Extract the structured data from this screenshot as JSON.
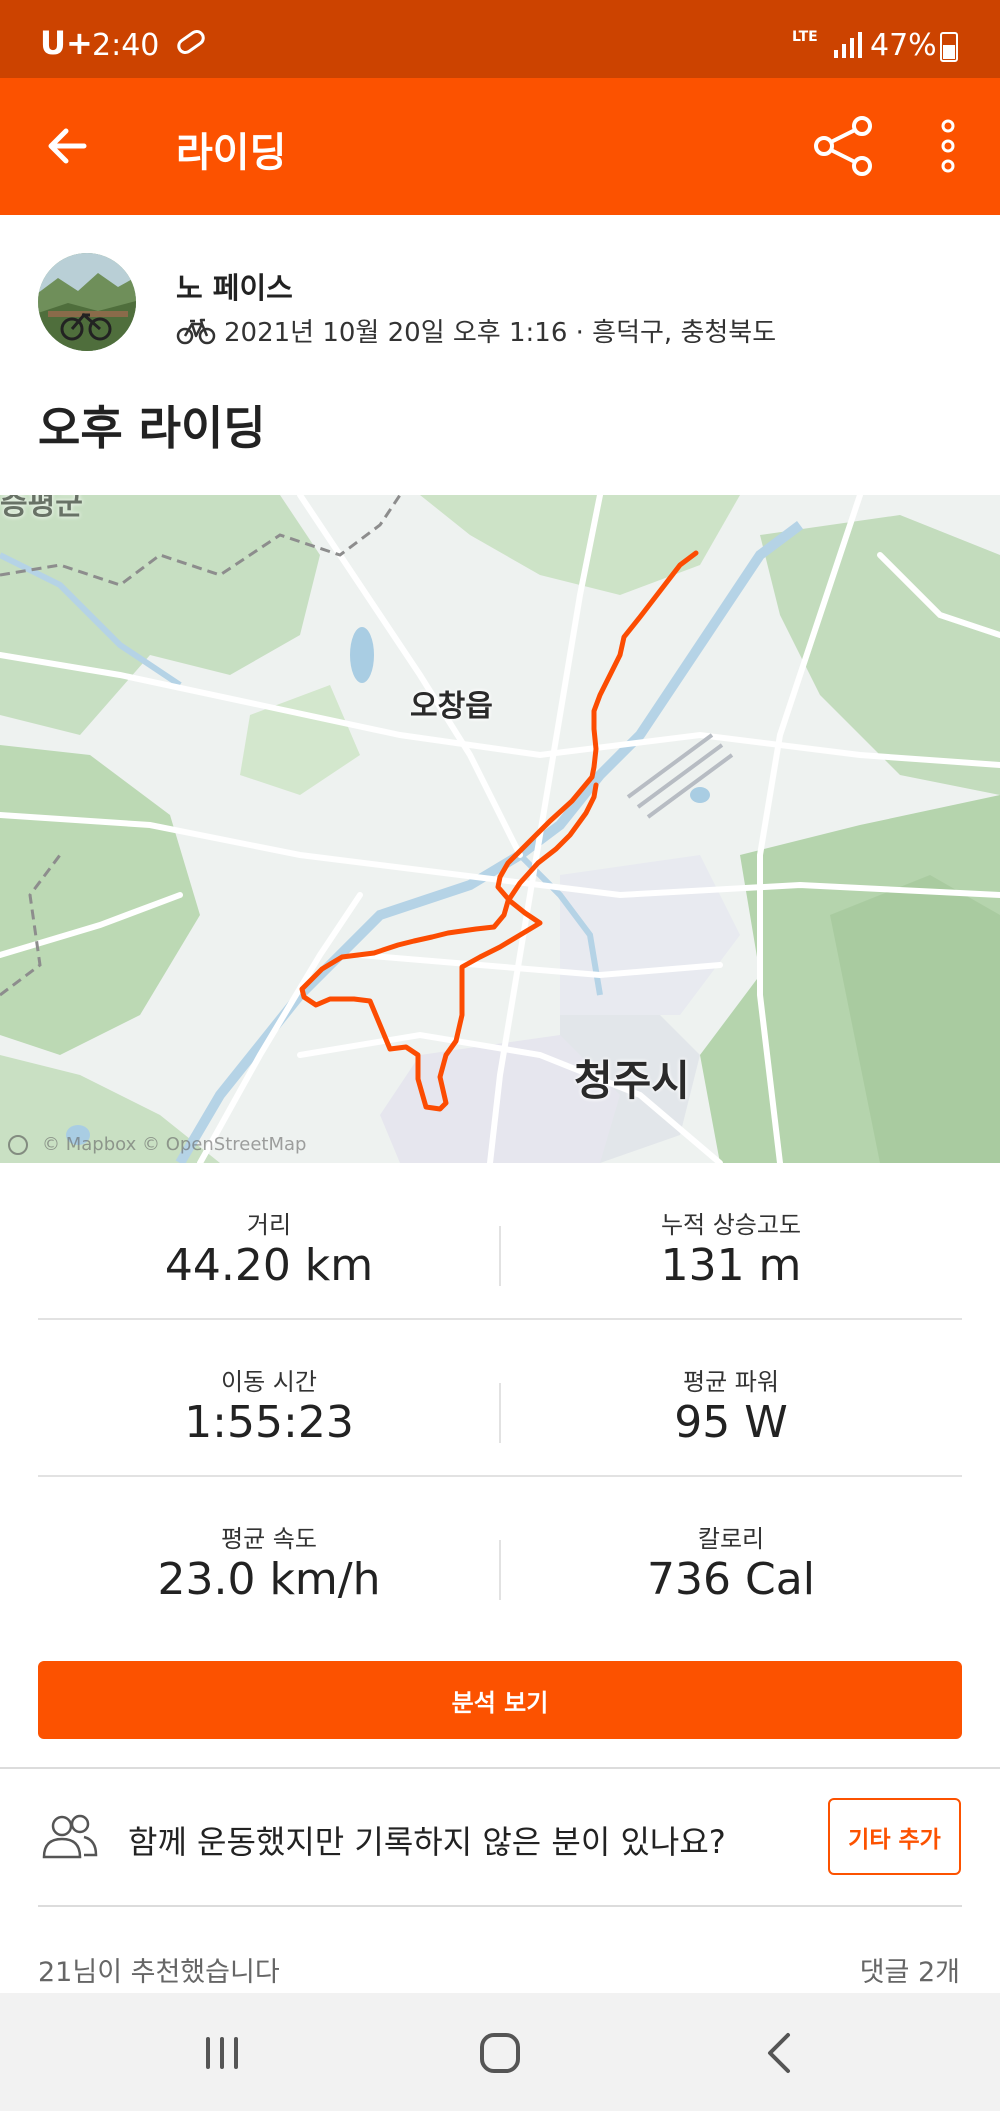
{
  "status_bar": {
    "carrier": "U+",
    "time": "2:40",
    "network": "LTE",
    "battery": "47%"
  },
  "app_bar": {
    "title": "라이딩",
    "icons": [
      "back-arrow-icon",
      "share-icon",
      "more-vert-icon"
    ]
  },
  "athlete": {
    "name": "노 페이스",
    "activity_icon": "bicycle-icon",
    "meta": "2021년 10월 20일 오후 1:16 · 흥덕구, 충청북도"
  },
  "activity": {
    "title": "오후 라이딩"
  },
  "map": {
    "labels": {
      "town": "오창읍",
      "city": "청주시",
      "top_left_partial": "증평군"
    },
    "attribution": "© Mapbox © OpenStreetMap",
    "route_color": "#fc4c02"
  },
  "stats": [
    {
      "label": "거리",
      "value": "44.20 km"
    },
    {
      "label": "누적 상승고도",
      "value": "131 m"
    },
    {
      "label": "이동 시간",
      "value": "1:55:23"
    },
    {
      "label": "평균 파워",
      "value": "95 W"
    },
    {
      "label": "평균 속도",
      "value": "23.0 km/h"
    },
    {
      "label": "칼로리",
      "value": "736 Cal"
    }
  ],
  "analysis_button": "분석 보기",
  "group": {
    "question": "함께 운동했지만 기록하지 않은 분이 있나요?",
    "add_button": "기타 추가"
  },
  "social": {
    "kudos": "21님이 추천했습니다",
    "comments": "댓글 2개"
  },
  "colors": {
    "brand": "#fc5200",
    "status_bar": "#cc4300"
  }
}
